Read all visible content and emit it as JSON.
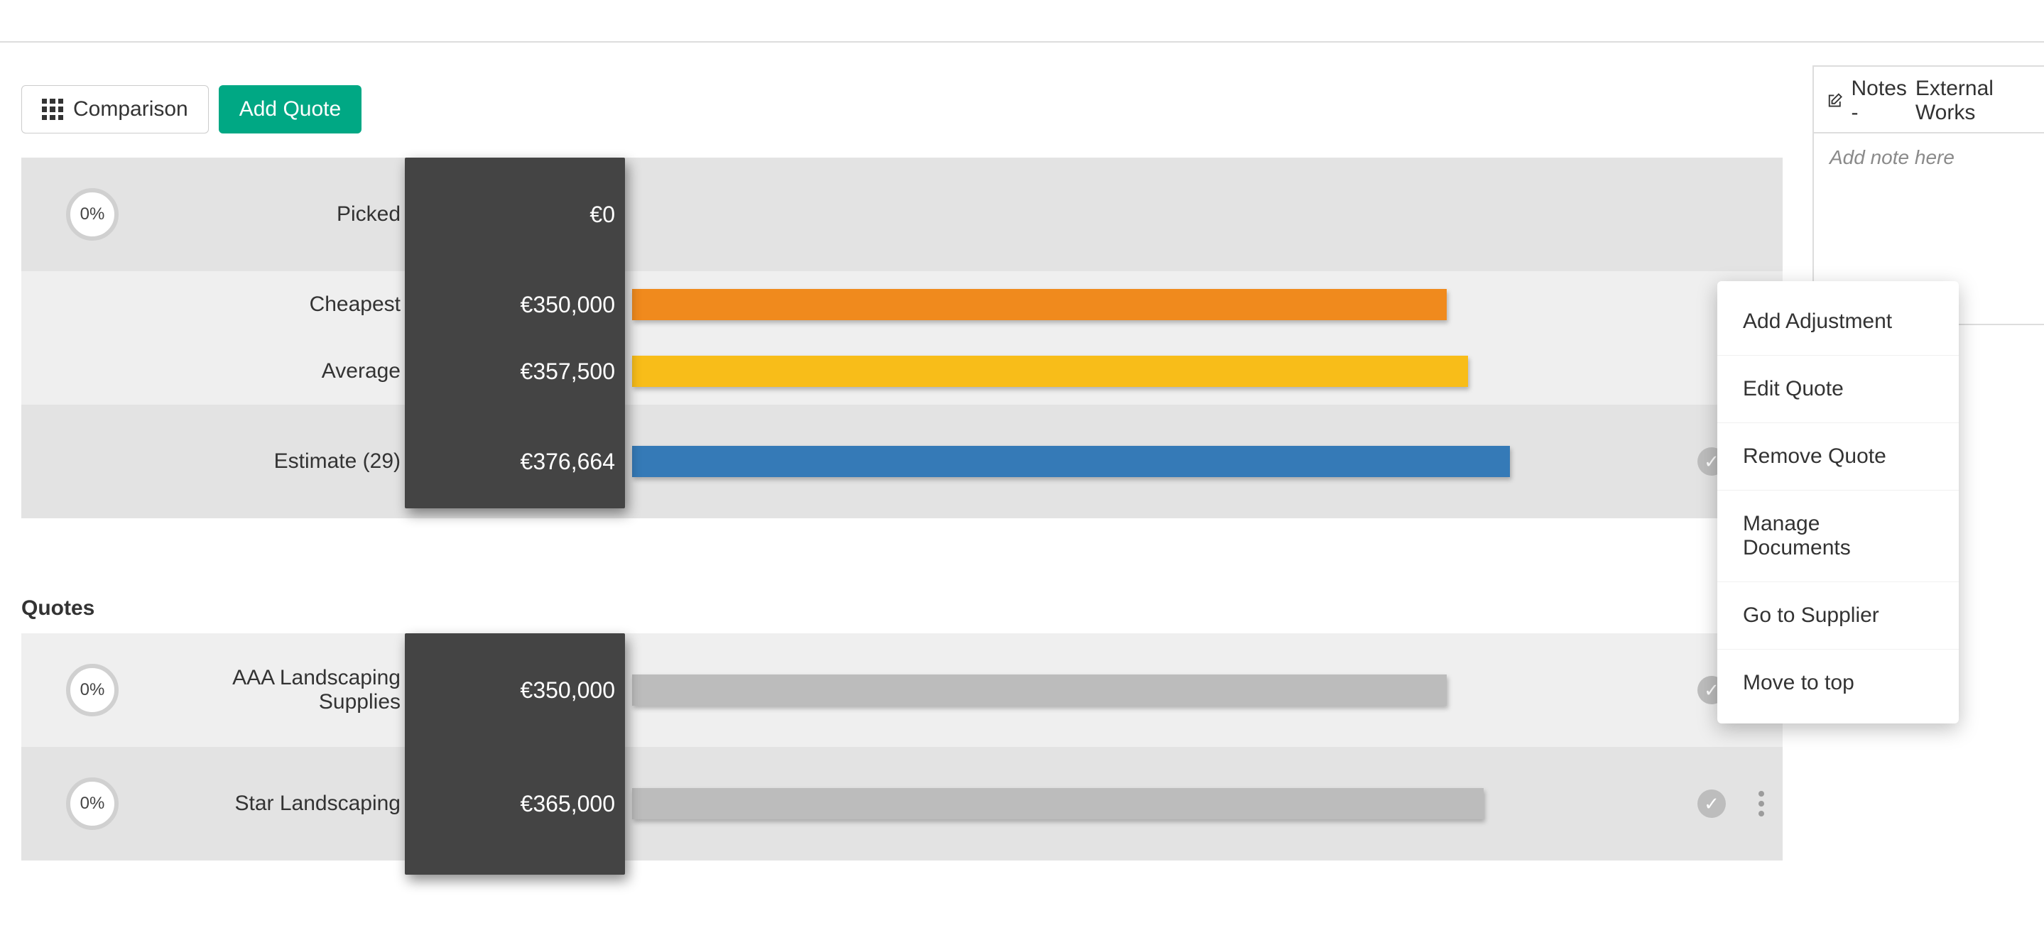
{
  "toolbar": {
    "comparison_label": "Comparison",
    "add_quote_label": "Add Quote"
  },
  "summary": {
    "picked": {
      "pct": "0%",
      "label": "Picked",
      "value": "€0",
      "bar": 0,
      "color": null
    },
    "cheapest": {
      "label": "Cheapest",
      "value": "€350,000",
      "bar": 77.5,
      "color": "orange"
    },
    "average": {
      "label": "Average",
      "value": "€357,500",
      "bar": 79.5,
      "color": "yellow"
    },
    "estimate": {
      "label": "Estimate (29)",
      "value": "€376,664",
      "bar": 83.5,
      "color": "blue",
      "tick": true
    }
  },
  "quotes_heading": "Quotes",
  "quotes": [
    {
      "pct": "0%",
      "label": "AAA Landscaping Supplies",
      "value": "€350,000",
      "bar": 77.5,
      "tick": true,
      "kebab": true
    },
    {
      "pct": "0%",
      "label": "Star Landscaping",
      "value": "€365,000",
      "bar": 81.0,
      "tick": true,
      "kebab": true
    }
  ],
  "menu": {
    "items": [
      "Add Adjustment",
      "Edit Quote",
      "Remove Quote",
      "Manage Documents",
      "Go to Supplier",
      "Move to top"
    ]
  },
  "notes": {
    "title_prefix": "Notes - ",
    "title_subject": "External Works",
    "placeholder": "Add note here"
  },
  "chart_data": {
    "type": "bar",
    "title": "",
    "xlabel": "",
    "ylabel": "",
    "series": [
      {
        "name": "Picked",
        "value": 0
      },
      {
        "name": "Cheapest",
        "value": 350000
      },
      {
        "name": "Average",
        "value": 357500
      },
      {
        "name": "Estimate (29)",
        "value": 376664
      },
      {
        "name": "AAA Landscaping Supplies",
        "value": 350000
      },
      {
        "name": "Star Landscaping",
        "value": 365000
      }
    ],
    "currency": "EUR"
  }
}
